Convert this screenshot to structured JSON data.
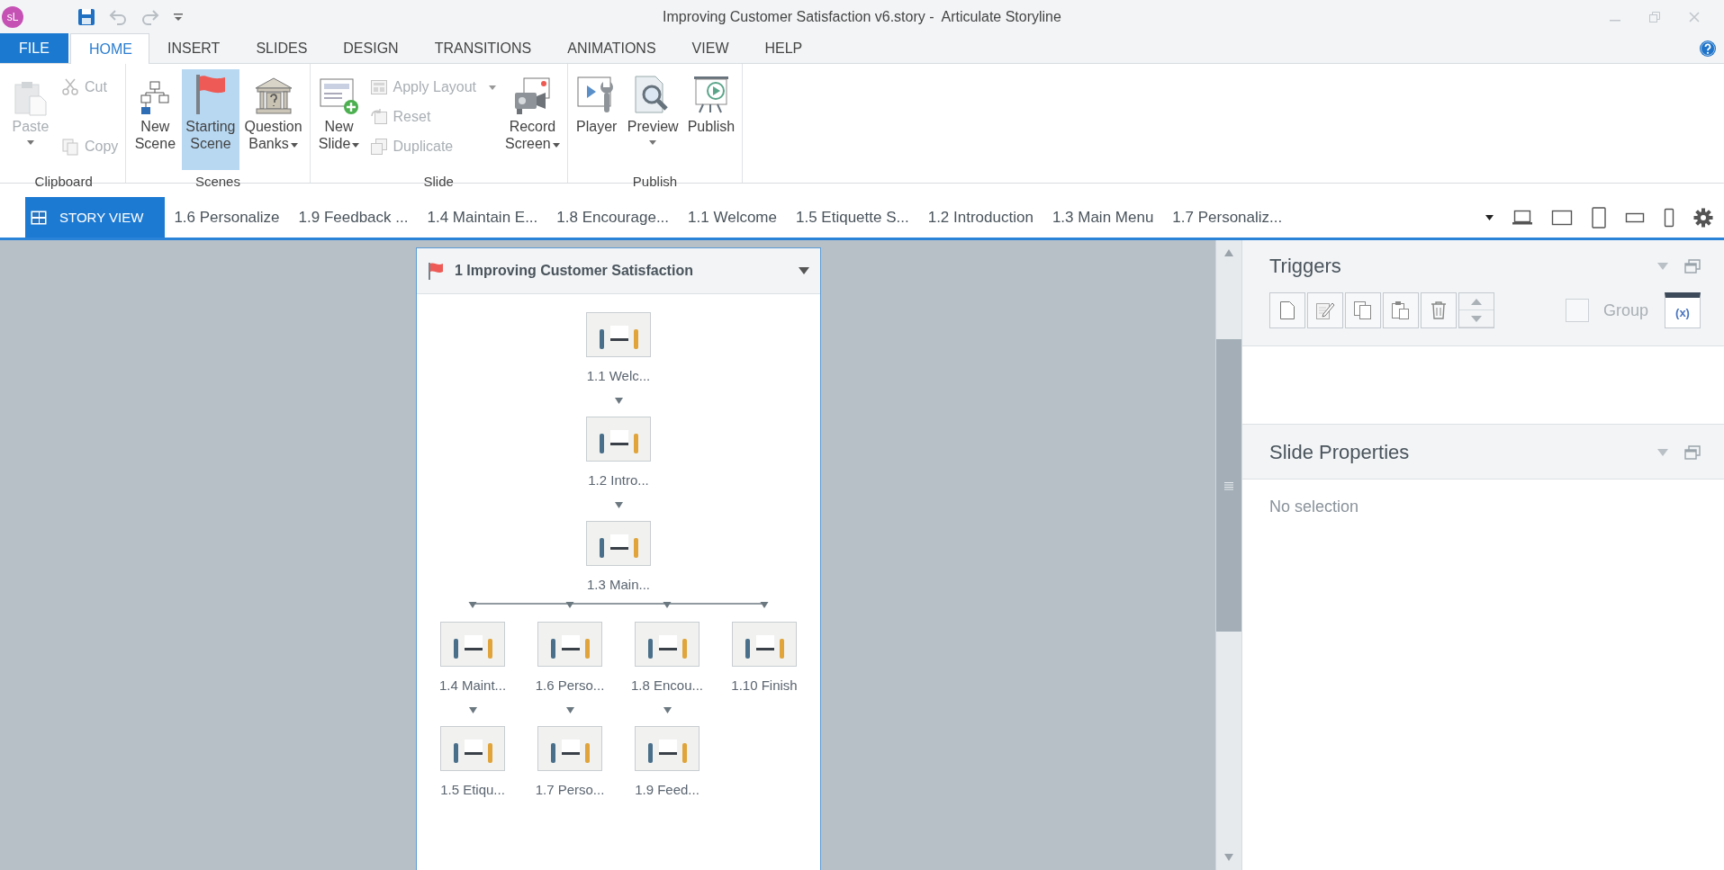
{
  "app": {
    "logo": "sL",
    "title": "Improving Customer Satisfaction v6.story -  Articulate Storyline"
  },
  "menu_tabs": [
    {
      "label": "FILE",
      "kind": "file",
      "selected": false
    },
    {
      "label": "HOME",
      "kind": "tab",
      "selected": true
    },
    {
      "label": "INSERT",
      "kind": "tab",
      "selected": false
    },
    {
      "label": "SLIDES",
      "kind": "tab",
      "selected": false
    },
    {
      "label": "DESIGN",
      "kind": "tab",
      "selected": false
    },
    {
      "label": "TRANSITIONS",
      "kind": "tab",
      "selected": false
    },
    {
      "label": "ANIMATIONS",
      "kind": "tab",
      "selected": false
    },
    {
      "label": "VIEW",
      "kind": "tab",
      "selected": false
    },
    {
      "label": "HELP",
      "kind": "tab",
      "selected": false
    }
  ],
  "ribbon": {
    "groups": [
      {
        "label": "Clipboard",
        "items": [
          {
            "kind": "large",
            "label": [
              "Paste"
            ],
            "dropdown": true,
            "disabled": true,
            "selected": false
          },
          {
            "kind": "small",
            "label": [
              "Cut"
            ],
            "dropdown": false,
            "disabled": true,
            "selected": false
          },
          {
            "kind": "small",
            "label": [
              "Copy"
            ],
            "dropdown": false,
            "disabled": true,
            "selected": false
          }
        ]
      },
      {
        "label": "Scenes",
        "items": [
          {
            "kind": "large",
            "label": [
              "New",
              "Scene"
            ],
            "dropdown": false,
            "disabled": false,
            "selected": false
          },
          {
            "kind": "large",
            "label": [
              "Starting",
              "Scene"
            ],
            "dropdown": false,
            "disabled": false,
            "selected": true
          },
          {
            "kind": "large",
            "label": [
              "Question",
              "Banks"
            ],
            "dropdown": true,
            "disabled": false,
            "selected": false
          }
        ]
      },
      {
        "label": "Slide",
        "items": [
          {
            "kind": "large",
            "label": [
              "New",
              "Slide"
            ],
            "dropdown": true,
            "disabled": false,
            "selected": false
          },
          {
            "kind": "small",
            "label": [
              "Apply Layout"
            ],
            "dropdown": true,
            "disabled": true,
            "selected": false
          },
          {
            "kind": "small",
            "label": [
              "Reset"
            ],
            "dropdown": false,
            "disabled": true,
            "selected": false
          },
          {
            "kind": "small",
            "label": [
              "Duplicate"
            ],
            "dropdown": false,
            "disabled": true,
            "selected": false
          },
          {
            "kind": "large",
            "label": [
              "Record",
              "Screen"
            ],
            "dropdown": true,
            "disabled": false,
            "selected": false
          }
        ]
      },
      {
        "label": "Publish",
        "items": [
          {
            "kind": "large",
            "label": [
              "Player"
            ],
            "dropdown": false,
            "disabled": false,
            "selected": false
          },
          {
            "kind": "large",
            "label": [
              "Preview"
            ],
            "dropdown": true,
            "disabled": false,
            "selected": false
          },
          {
            "kind": "large",
            "label": [
              "Publish"
            ],
            "dropdown": false,
            "disabled": false,
            "selected": false
          }
        ]
      }
    ]
  },
  "slide_tabs": [
    {
      "label": "STORY VIEW",
      "kind": "story",
      "selected": true
    },
    {
      "label": "1.6 Personalize",
      "kind": "slide",
      "selected": false
    },
    {
      "label": "1.9 Feedback ...",
      "kind": "slide",
      "selected": false
    },
    {
      "label": "1.4 Maintain E...",
      "kind": "slide",
      "selected": false
    },
    {
      "label": "1.8 Encourage...",
      "kind": "slide",
      "selected": false
    },
    {
      "label": "1.1 Welcome",
      "kind": "slide",
      "selected": false
    },
    {
      "label": "1.5 Etiquette S...",
      "kind": "slide",
      "selected": false
    },
    {
      "label": "1.2 Introduction",
      "kind": "slide",
      "selected": false
    },
    {
      "label": "1.3 Main Menu",
      "kind": "slide",
      "selected": false
    },
    {
      "label": "1.7 Personaliz...",
      "kind": "slide",
      "selected": false
    }
  ],
  "scene": {
    "title": "1 Improving Customer Satisfaction",
    "slides": [
      {
        "label": "1.1 Welc...",
        "children": [
          {
            "label": "1.2 Intro...",
            "children": [
              {
                "label": "1.3 Main...",
                "children": [
                  {
                    "label": "1.4 Maint...",
                    "children": [
                      {
                        "label": "1.5 Etiqu..."
                      }
                    ]
                  },
                  {
                    "label": "1.6 Perso...",
                    "children": [
                      {
                        "label": "1.7 Perso..."
                      }
                    ]
                  },
                  {
                    "label": "1.8 Encou...",
                    "children": [
                      {
                        "label": "1.9 Feed..."
                      }
                    ]
                  },
                  {
                    "label": "1.10 Finish"
                  }
                ]
              }
            ]
          }
        ]
      }
    ]
  },
  "triggers": {
    "title": "Triggers",
    "group_label": "Group",
    "group_checked": false,
    "variables_button": "(x)"
  },
  "slide_properties": {
    "title": "Slide Properties",
    "empty_text": "No selection"
  }
}
